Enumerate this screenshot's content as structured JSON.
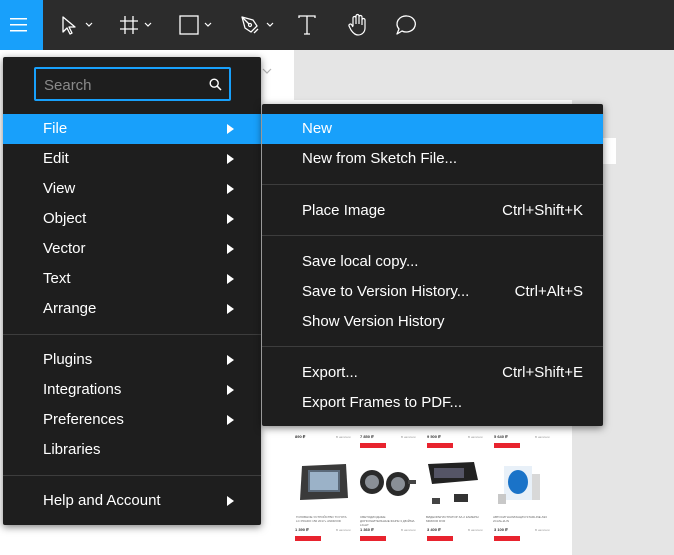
{
  "toolbar": {
    "menu_icon": "hamburger-icon",
    "tools": [
      {
        "name": "move-tool",
        "icon": "cursor-arrow-icon"
      },
      {
        "name": "frame-tool",
        "icon": "hash-frame-icon"
      },
      {
        "name": "shape-tool",
        "icon": "rectangle-icon"
      },
      {
        "name": "pen-tool",
        "icon": "pen-nib-icon"
      },
      {
        "name": "text-tool",
        "icon": "text-t-icon"
      },
      {
        "name": "hand-tool",
        "icon": "hand-icon"
      },
      {
        "name": "comment-tool",
        "icon": "speech-bubble-icon"
      }
    ]
  },
  "menu": {
    "search_placeholder": "Search",
    "items": [
      {
        "label": "File"
      },
      {
        "label": "Edit"
      },
      {
        "label": "View"
      },
      {
        "label": "Object"
      },
      {
        "label": "Vector"
      },
      {
        "label": "Text"
      },
      {
        "label": "Arrange"
      },
      {
        "label": "Plugins"
      },
      {
        "label": "Integrations"
      },
      {
        "label": "Preferences"
      },
      {
        "label": "Libraries"
      },
      {
        "label": "Help and Account"
      }
    ]
  },
  "submenu": {
    "items": [
      {
        "label": "New",
        "shortcut": ""
      },
      {
        "label": "New from Sketch File...",
        "shortcut": ""
      },
      {
        "label": "Place Image",
        "shortcut": "Ctrl+Shift+K"
      },
      {
        "label": "Save local copy...",
        "shortcut": ""
      },
      {
        "label": "Save to Version History...",
        "shortcut": "Ctrl+Alt+S"
      },
      {
        "label": "Show Version History",
        "shortcut": ""
      },
      {
        "label": "Export...",
        "shortcut": "Ctrl+Shift+E"
      },
      {
        "label": "Export Frames to PDF...",
        "shortcut": ""
      }
    ]
  },
  "canvas": {
    "prices_row1": [
      "890 ₽",
      "7 850 ₽",
      "9 500 ₽",
      "5 640 ₽"
    ],
    "prices_row2": [
      "1 390 ₽",
      "1 360 ₽",
      "3 400 ₽",
      "3 100 ₽"
    ],
    "availability": "В наличии",
    "descriptions": [
      "ГОЛОВНОЕ УСТРОЙСТВО TOYOTA LC PRADO 150 2017+ ANDROID",
      "СВЕТОДИОДНЫЕ ДОПОЛНИТЕЛЬНЫЕ ФАРЫ 3 ДЮЙМА LIGHT",
      "ВИДЕОРЕГИСТРАТОР ЗА 2 КАМЕРЫ MIRROR DVR",
      "АВТОСИГНАЛИЗАЦИЯ STARLINE A93 2CAN+2LIN"
    ],
    "colors": {
      "accent": "#18a0fb",
      "toolbar": "#2c2c2c",
      "menu": "#1e1e1e",
      "buy_button": "#e8232e"
    }
  }
}
